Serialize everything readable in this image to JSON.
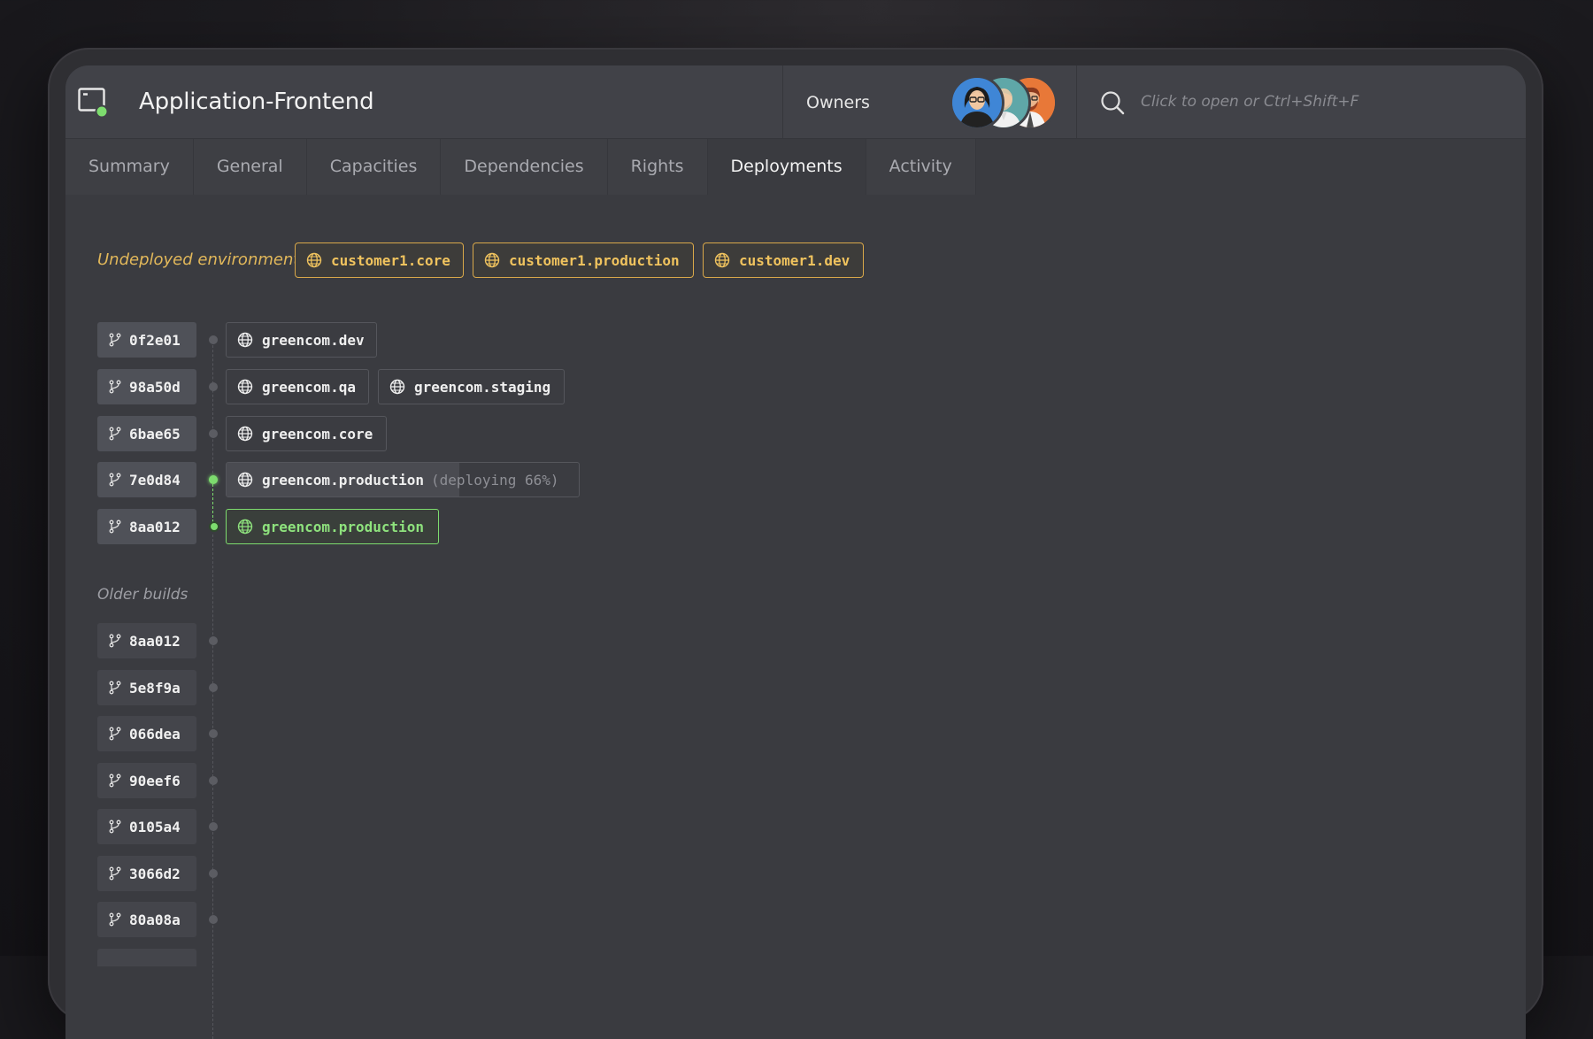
{
  "header": {
    "title": "Application-Frontend",
    "owners_label": "Owners",
    "search_placeholder": "Click to open or Ctrl+Shift+F"
  },
  "tabs": [
    {
      "label": "Summary",
      "active": false
    },
    {
      "label": "General",
      "active": false
    },
    {
      "label": "Capacities",
      "active": false
    },
    {
      "label": "Dependencies",
      "active": false
    },
    {
      "label": "Rights",
      "active": false
    },
    {
      "label": "Deployments",
      "active": true
    },
    {
      "label": "Activity",
      "active": false
    }
  ],
  "undeployed": {
    "label": "Undeployed environments:",
    "environments": [
      "customer1.core",
      "customer1.production",
      "customer1.dev"
    ]
  },
  "builds": [
    {
      "hash": "0f2e01",
      "deployments": [
        {
          "env": "greencom.dev"
        }
      ]
    },
    {
      "hash": "98a50d",
      "deployments": [
        {
          "env": "greencom.qa"
        },
        {
          "env": "greencom.staging"
        }
      ]
    },
    {
      "hash": "6bae65",
      "deployments": [
        {
          "env": "greencom.core"
        }
      ]
    },
    {
      "hash": "7e0d84",
      "deployments": [
        {
          "env": "greencom.production",
          "status": "(deploying 66%)",
          "progress": 0.66
        }
      ]
    },
    {
      "hash": "8aa012",
      "deployments": [
        {
          "env": "greencom.production",
          "current": true
        }
      ]
    }
  ],
  "older": {
    "label": "Older builds",
    "builds": [
      "8aa012",
      "5e8f9a",
      "066dea",
      "90eef6",
      "0105a4",
      "3066d2",
      "80a08a"
    ]
  },
  "colors": {
    "undeployed_accent": "#e2b85a",
    "current_accent": "#7ddc6e"
  },
  "icons": {
    "branch": "git-branch-icon",
    "globe": "globe-icon",
    "search": "search-icon"
  }
}
